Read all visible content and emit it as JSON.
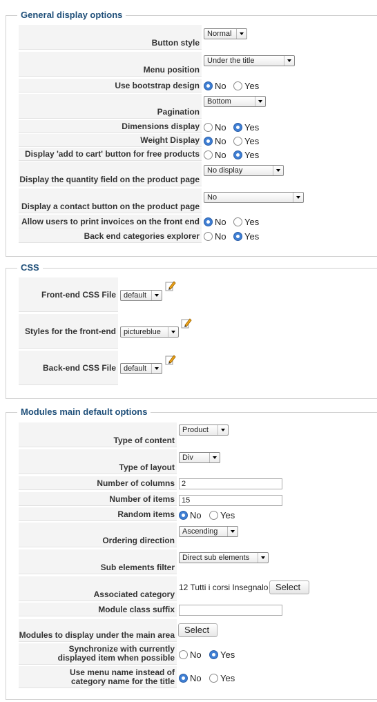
{
  "general": {
    "legend": "General display options",
    "button_style": {
      "label": "Button style",
      "value": "Normal"
    },
    "menu_position": {
      "label": "Menu position",
      "value": "Under the title"
    },
    "bootstrap": {
      "label": "Use bootstrap design"
    },
    "pagination": {
      "label": "Pagination",
      "value": "Bottom"
    },
    "dimensions": {
      "label": "Dimensions display"
    },
    "weight": {
      "label": "Weight Display"
    },
    "add_to_cart_free": {
      "label": "Display 'add to cart' button for free products"
    },
    "quantity_field": {
      "label": "Display the quantity field on the product page",
      "value": "No display"
    },
    "contact_button": {
      "label": "Display a contact button on the product page",
      "value": "No"
    },
    "print_invoices": {
      "label": "Allow users to print invoices on the front end"
    },
    "categories_explorer": {
      "label": "Back end categories explorer"
    }
  },
  "css": {
    "legend": "CSS",
    "frontend_file": {
      "label": "Front-end CSS File",
      "value": "default"
    },
    "frontend_styles": {
      "label": "Styles for the front-end",
      "value": "pictureblue"
    },
    "backend_file": {
      "label": "Back-end CSS File",
      "value": "default"
    }
  },
  "modules": {
    "legend": "Modules main default options",
    "type_content": {
      "label": "Type of content",
      "value": "Product"
    },
    "type_layout": {
      "label": "Type of layout",
      "value": "Div"
    },
    "columns": {
      "label": "Number of columns",
      "value": "2"
    },
    "items": {
      "label": "Number of items",
      "value": "15"
    },
    "random": {
      "label": "Random items"
    },
    "ordering": {
      "label": "Ordering direction",
      "value": "Ascending"
    },
    "sub_filter": {
      "label": "Sub elements filter",
      "value": "Direct sub elements"
    },
    "assoc_category": {
      "label": "Associated category",
      "value": "12 Tutti i corsi Insegnalo",
      "button": "Select"
    },
    "class_suffix": {
      "label": "Module class suffix",
      "value": ""
    },
    "display_under": {
      "label": "Modules to display under the main area",
      "button": "Select"
    },
    "sync": {
      "label_1": "Synchronize with currently",
      "label_2": "displayed item when possible"
    },
    "menu_name": {
      "label_1": "Use menu name instead of",
      "label_2": "category name for the title"
    }
  },
  "common": {
    "no": "No",
    "yes": "Yes"
  },
  "icons": {
    "edit": "edit-pencil-icon"
  }
}
